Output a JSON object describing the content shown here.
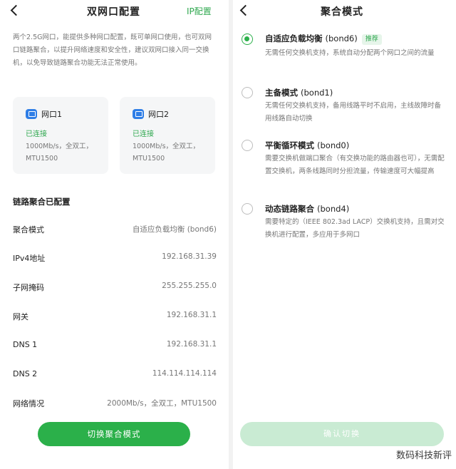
{
  "left": {
    "title": "双网口配置",
    "action": "IP配置",
    "intro": "两个2.5G网口，能提供多种网口配置，既可单网口使用，也可双网口链路聚合，以提升网络速度和安全性，建议双网口接入同一交换机，以免导致链路聚合功能无法正常使用。",
    "ports": [
      {
        "name": "网口1",
        "status": "已连接",
        "desc": "1000Mb/s，全双工，MTU1500"
      },
      {
        "name": "网口2",
        "status": "已连接",
        "desc": "1000Mb/s，全双工，MTU1500"
      }
    ],
    "section": "链路聚合已配置",
    "rows": [
      {
        "key": "聚合模式",
        "value": "自适应负载均衡 (bond6)"
      },
      {
        "key": "IPv4地址",
        "value": "192.168.31.39"
      },
      {
        "key": "子网掩码",
        "value": "255.255.255.0"
      },
      {
        "key": "网关",
        "value": "192.168.31.1"
      },
      {
        "key": "DNS 1",
        "value": "192.168.31.1"
      },
      {
        "key": "DNS 2",
        "value": "114.114.114.114"
      },
      {
        "key": "网络情况",
        "value": "2000Mb/s，全双工，MTU1500"
      }
    ],
    "button": "切换聚合模式"
  },
  "right": {
    "title": "聚合模式",
    "options": [
      {
        "name": "自适应负载均衡",
        "code": "(bond6)",
        "badge": "推荐",
        "selected": true,
        "desc": "无需任何交换机支持，系统自动分配两个网口之间的流量"
      },
      {
        "name": "主备模式",
        "code": "(bond1)",
        "badge": "",
        "selected": false,
        "desc": "无需任何交换机支持，备用线路平时不启用，主线故障时备用线路自动切换"
      },
      {
        "name": "平衡循环模式",
        "code": "(bond0)",
        "badge": "",
        "selected": false,
        "desc": "需要交换机做端口聚合（有交换功能的路由器也可），无需配置交换机，两条线路同时分担流量，传输速度可大幅提高"
      },
      {
        "name": "动态链路聚合",
        "code": "(bond4)",
        "badge": "",
        "selected": false,
        "desc": "需要特定的（IEEE 802.3ad LACP）交换机支持，且需对交换机进行配置，多应用于多网口"
      }
    ],
    "button": "确认切换"
  },
  "watermark": "数码科技新评",
  "colors": {
    "accent": "#2bb04a",
    "accent_disabled": "#c9ebd3",
    "link": "#2fa84f",
    "port_icon": "#2f7ee6"
  },
  "icons": {
    "back": "chevron-left-icon",
    "port": "ethernet-port-icon"
  }
}
